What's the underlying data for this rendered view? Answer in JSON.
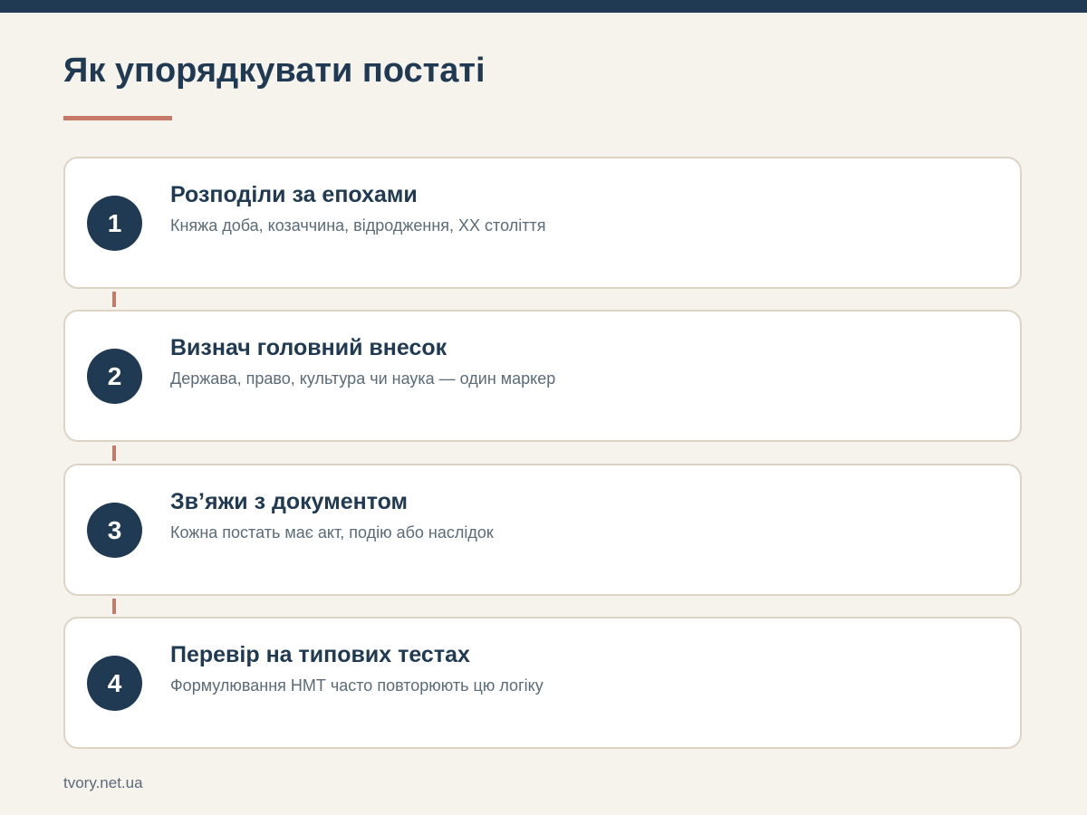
{
  "page": {
    "title": "Як упорядкувати постаті"
  },
  "steps": [
    {
      "number": "1",
      "title": "Розподіли за епохами",
      "description": "Княжа доба, козаччина, відродження, XX століття"
    },
    {
      "number": "2",
      "title": "Визнач головний внесок",
      "description": "Держава, право, культура чи наука — один маркер"
    },
    {
      "number": "3",
      "title": "Зв’яжи з документом",
      "description": "Кожна постать має акт, подію або наслідок"
    },
    {
      "number": "4",
      "title": "Перевір на типових тестах",
      "description": "Формулювання НМТ часто повторюють цю логіку"
    }
  ],
  "footer": {
    "source": "tvory.net.ua"
  },
  "colors": {
    "background": "#f6f2ec",
    "primary": "#1f3a52",
    "accent": "#c47a66",
    "card_border": "#ddd4c6",
    "muted_text": "#5b6b78"
  }
}
